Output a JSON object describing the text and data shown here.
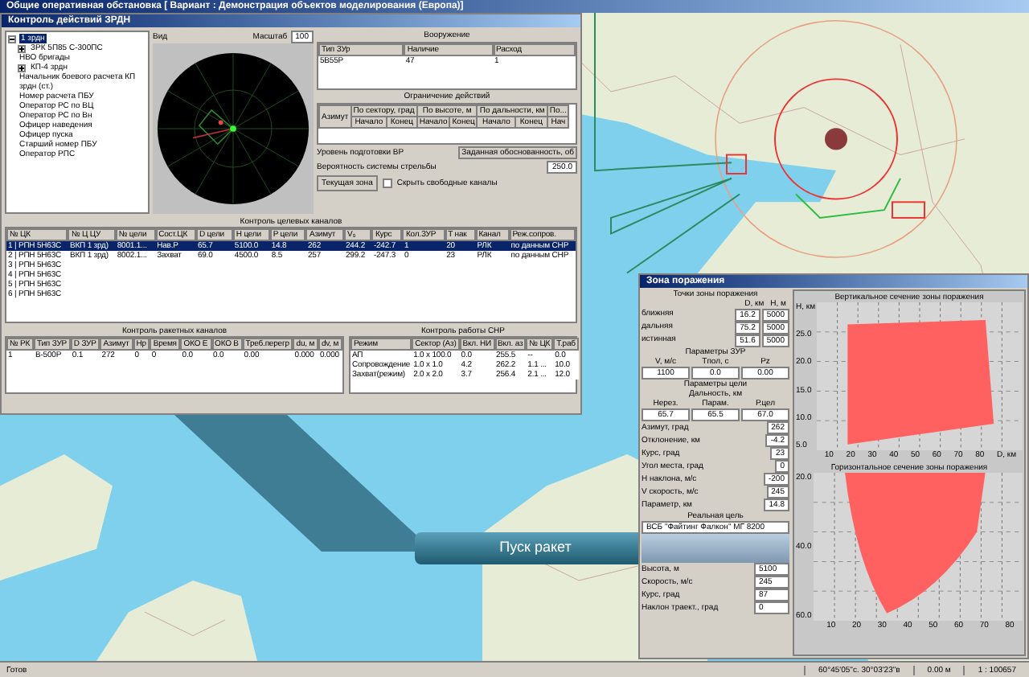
{
  "window": {
    "title": "Общие оперативная обстановка [ Вариант : Демонстрация объектов моделирования (Европа)]"
  },
  "control_window": {
    "title": "Контроль действий ЗРДН",
    "tree": [
      {
        "label": "1 зрдн",
        "selected": true,
        "expanded": true,
        "children": [
          {
            "label": "ЗРК 5П85 С-300ПС",
            "selected": false,
            "expanded": false
          },
          {
            "label": "НВО бригады",
            "selected": false
          },
          {
            "label": "КП-4 зрдн",
            "selected": false,
            "expanded": false
          },
          {
            "label": "Начальник боевого расчета КП зрдн (ст.)",
            "selected": false
          },
          {
            "label": "Номер расчета ПБУ",
            "selected": false
          },
          {
            "label": "Оператор РС по ВЦ",
            "selected": false
          },
          {
            "label": "Оператор РС по Вн",
            "selected": false
          },
          {
            "label": "Офицер наведения",
            "selected": false
          },
          {
            "label": "Офицер пуска",
            "selected": false
          },
          {
            "label": "Старший номер ПБУ",
            "selected": false
          },
          {
            "label": "Оператор РПС",
            "selected": false
          }
        ]
      }
    ],
    "view": {
      "title": "Вид",
      "scale_label": "Масштаб",
      "scale_value": "100"
    },
    "weapons": {
      "title": "Вооружение",
      "columns": [
        "Тип ЗУр",
        "Наличие",
        "Расход"
      ],
      "rows": [
        [
          "5В55Р",
          "47",
          "1"
        ]
      ]
    },
    "limits": {
      "title": "Ограничение действий",
      "first_column": "Азимут",
      "groups": [
        {
          "label": "По сектору, град",
          "subcolumns": [
            "Начало",
            "Конец"
          ]
        },
        {
          "label": "По высоте, м",
          "subcolumns": [
            "Начало",
            "Конец"
          ]
        },
        {
          "label": "По дальности, км",
          "subcolumns": [
            "Начало",
            "Конец"
          ]
        },
        {
          "label": "По...",
          "subcolumns": [
            "Нач"
          ]
        }
      ]
    },
    "readiness_label": "Уровень подготовки ВР",
    "readiness_button": "Заданная обоснованность, об",
    "probability_label": "Вероятность системы стрельбы",
    "probability_value": "250.0",
    "current_zone_button": "Текущая зона",
    "hide_free_channels": {
      "label": "Скрыть свободные каналы",
      "checked": false
    },
    "target_channels": {
      "title": "Контроль целевых каналов",
      "columns": [
        "№ ЦК",
        "№ Ц ЦУ",
        "№ цели",
        "Сост.ЦК",
        "D цели",
        "H цели",
        "P цели",
        "Азимут",
        "V₀",
        "Курс",
        "Кол.ЗУР",
        "Т нак",
        "Канал",
        "Реж.сопров."
      ],
      "rows": [
        {
          "selected": true,
          "cells": [
            "1 | РПН 5Н63С",
            "ВКП 1 зрд)",
            "8001.1...",
            "Нав.Р",
            "65.7",
            "5100.0",
            "14.8",
            "262",
            "244.2",
            "-242.7",
            "1",
            "20",
            "РЛК",
            "по данным СНР"
          ]
        },
        {
          "selected": false,
          "cells": [
            "2 | РПН 5Н63С",
            "ВКП 1 зрд)",
            "8002.1...",
            "Захват",
            "69.0",
            "4500.0",
            "8.5",
            "257",
            "299.2",
            "-247.3",
            "0",
            "23",
            "РЛК",
            "по данным СНР"
          ]
        },
        {
          "selected": false,
          "cells": [
            "3 | РПН 5Н63С"
          ]
        },
        {
          "selected": false,
          "cells": [
            "4 | РПН 5Н63С"
          ]
        },
        {
          "selected": false,
          "cells": [
            "5 | РПН 5Н63С"
          ]
        },
        {
          "selected": false,
          "cells": [
            "6 | РПН 5Н63С"
          ]
        }
      ]
    },
    "missile_channels": {
      "title": "Контроль ракетных каналов",
      "columns": [
        "№ РК",
        "Тип ЗУР",
        "D ЗУР",
        "Азимут",
        "Нр",
        "Время",
        "ОКО Е",
        "ОКО В",
        "Треб.перегр",
        "du, м",
        "dv, м"
      ],
      "rows": [
        [
          "1",
          "В-500Р",
          "0.1",
          "272",
          "0",
          "0",
          "0.0",
          "0.0",
          "0.00",
          "0.000",
          "0.000"
        ]
      ]
    },
    "snr": {
      "title": "Контроль работы СНР",
      "columns": [
        "Режим",
        "Сектор (Аз)",
        "Вкл. НИ",
        "Вкл. аз",
        "№ ЦК",
        "Т.раб"
      ],
      "rows": [
        [
          "АП",
          "1.0 x 100.0",
          "0.0",
          "255.5",
          "--",
          "0.0"
        ],
        [
          "Сопровождение",
          "1.0 x 1.0",
          "4.2",
          "262.2",
          "1.1 ...",
          "10.0"
        ],
        [
          "Захват(режим)",
          "2.0 x 2.0",
          "3.7",
          "256.4",
          "2.1 ...",
          "12.0"
        ]
      ]
    }
  },
  "zone_window": {
    "title": "Зона поражения",
    "points": {
      "title": "Точки зоны поражения",
      "value_columns": [
        "D, км",
        "H, м"
      ],
      "rows": [
        {
          "label": "ближняя",
          "values": [
            "16.2",
            "5000"
          ]
        },
        {
          "label": "дальняя",
          "values": [
            "75.2",
            "5000"
          ]
        },
        {
          "label": "истинная",
          "values": [
            "51.6",
            "5000"
          ]
        }
      ]
    },
    "missile_params": {
      "title": "Параметры ЗУР",
      "columns": [
        "V, м/с",
        "Tпол, с",
        "Pz"
      ],
      "values": [
        "1100",
        "0.0",
        "0.00"
      ]
    },
    "target_params": {
      "title": "Параметры цели",
      "subtitle": "Дальность, км",
      "columns": [
        "Нерез.",
        "Парам.",
        "Р.цел"
      ],
      "values": [
        "65.7",
        "65.5",
        "67.0"
      ]
    },
    "target_fields": [
      [
        "Азимут, град",
        "262"
      ],
      [
        "Отклонение, км",
        "-4.2"
      ],
      [
        "Курс, град",
        "23"
      ],
      [
        "Угол места, град",
        "0"
      ],
      [
        "Н наклона, м/с",
        "-200"
      ],
      [
        "V скорость, м/с",
        "245"
      ],
      [
        "Параметр, км",
        "14.8"
      ]
    ],
    "real_target": {
      "title": "Реальная цель",
      "name": "ВСБ \"Файтинг Фалкон\" МГ 8200"
    },
    "inputs": [
      [
        "Высота, м",
        "5100"
      ],
      [
        "Скорость, м/с",
        "245"
      ],
      [
        "Курс, град",
        "87"
      ],
      [
        "Наклон траект., град",
        "0"
      ]
    ],
    "vertical_section": {
      "title": "Вертикальное сечение зоны поражения",
      "y_label": "H, км",
      "x_label": "D, км",
      "y_ticks": [
        "25.0",
        "20.0",
        "15.0",
        "10.0",
        "5.0"
      ],
      "x_ticks": [
        "10",
        "20",
        "30",
        "40",
        "50",
        "60",
        "70",
        "80"
      ]
    },
    "horizontal_section": {
      "title": "Горизонтальное сечение зоны поражения",
      "y_ticks": [
        "20.0",
        "40.0",
        "60.0"
      ],
      "x_ticks": [
        "10",
        "20",
        "30",
        "40",
        "50",
        "60",
        "70",
        "80"
      ]
    }
  },
  "callout": "Пуск ракет",
  "status_bar": [
    "Готов",
    "60°45'05\"с. 30°03'23\"в",
    "0.00 м",
    "1 : 100657"
  ]
}
